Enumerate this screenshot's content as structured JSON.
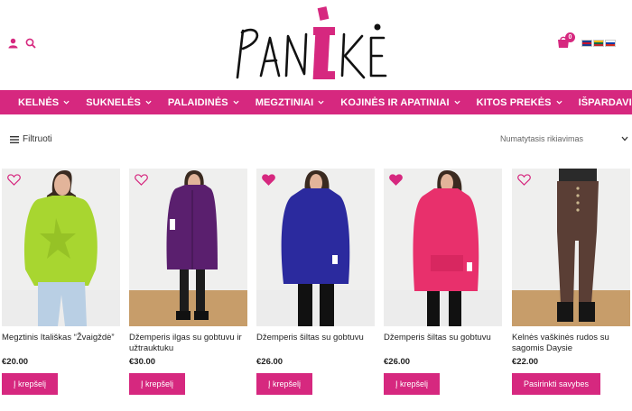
{
  "header": {
    "logo_text": "PANIKĖ",
    "cart_count": "0",
    "flags": [
      {
        "name": "uk-flag-icon",
        "colors": [
          "#1d3f8f",
          "#ffffff",
          "#c8102e"
        ]
      },
      {
        "name": "lt-flag-icon",
        "colors": [
          "#fdb913",
          "#006a44",
          "#c1272d"
        ]
      },
      {
        "name": "ru-flag-icon",
        "colors": [
          "#ffffff",
          "#0039a6",
          "#d52b1e"
        ]
      }
    ]
  },
  "nav": {
    "items": [
      {
        "label": "KELNĖS",
        "has_dropdown": true
      },
      {
        "label": "SUKNELĖS",
        "has_dropdown": true
      },
      {
        "label": "PALAIDINĖS",
        "has_dropdown": true
      },
      {
        "label": "MEGZTINIAI",
        "has_dropdown": true
      },
      {
        "label": "KOJINĖS IR APATINIAI",
        "has_dropdown": true
      },
      {
        "label": "KITOS PREKĖS",
        "has_dropdown": true
      },
      {
        "label": "IŠPARDAVIMAS",
        "has_dropdown": false
      }
    ]
  },
  "toolbar": {
    "filter_label": "Filtruoti",
    "sort_label": "Numatytasis rikiavimas"
  },
  "products": [
    {
      "name": "Megztinis Itališkas “Žvaigždė”",
      "price": "€20.00",
      "button": "Į krepšelį",
      "favorited": false,
      "garment_color": "#a8d630"
    },
    {
      "name": "Džemperis ilgas su gobtuvu ir užtrauktuku",
      "price": "€30.00",
      "button": "Į krepšelį",
      "favorited": false,
      "garment_color": "#5a1f6e"
    },
    {
      "name": "Džemperis šiltas su gobtuvu",
      "price": "€26.00",
      "button": "Į krepšelį",
      "favorited": true,
      "garment_color": "#2b2a9e"
    },
    {
      "name": "Džemperis šiltas su gobtuvu",
      "price": "€26.00",
      "button": "Į krepšelį",
      "favorited": true,
      "garment_color": "#e8306c"
    },
    {
      "name": "Kelnės vaškinės rudos su sagomis Daysie",
      "price": "€22.00",
      "button": "Pasirinkti savybes",
      "favorited": false,
      "garment_color": "#5a3e35"
    }
  ],
  "colors": {
    "accent": "#d6287f"
  }
}
